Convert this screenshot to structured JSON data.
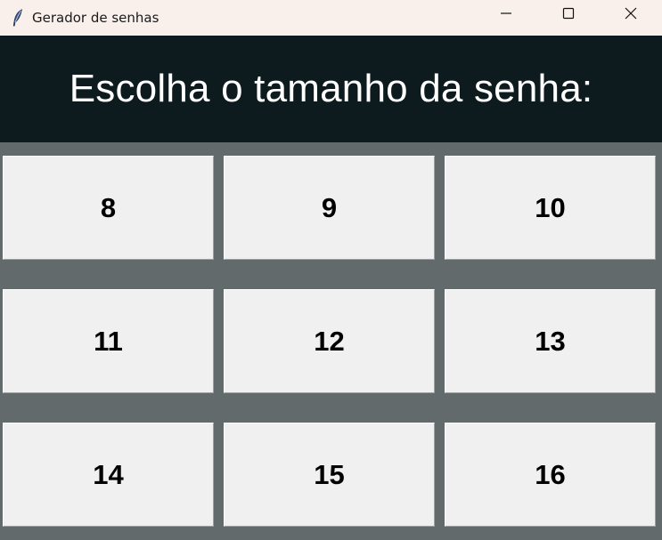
{
  "window": {
    "title": "Gerador de senhas",
    "icon": "feather-icon",
    "controls": [
      "minimize-icon",
      "maximize-icon",
      "close-icon"
    ]
  },
  "header": {
    "text": "Escolha o tamanho da senha:"
  },
  "buttons": [
    {
      "label": "8"
    },
    {
      "label": "9"
    },
    {
      "label": "10"
    },
    {
      "label": "11"
    },
    {
      "label": "12"
    },
    {
      "label": "13"
    },
    {
      "label": "14"
    },
    {
      "label": "15"
    },
    {
      "label": "16"
    }
  ],
  "colors": {
    "titlebar_bg": "#f9efeb",
    "header_bg": "#0d1b1f",
    "header_text": "#ffffff",
    "window_bg": "#636a6c",
    "button_bg": "#f0f0f0",
    "button_text": "#000000"
  }
}
